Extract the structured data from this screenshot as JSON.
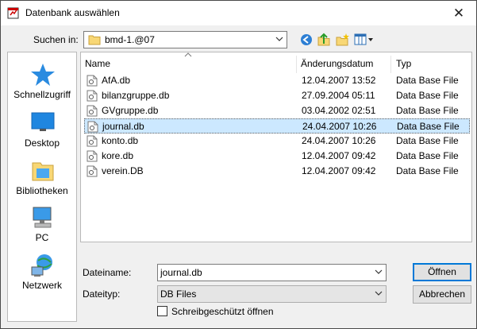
{
  "window": {
    "title": "Datenbank auswählen",
    "close_glyph": "✕"
  },
  "lookin": {
    "label": "Suchen in:",
    "value": "bmd-1.@07"
  },
  "places": [
    {
      "name": "place-quick-access",
      "label": "Schnellzugriff",
      "icon": "star-icon"
    },
    {
      "name": "place-desktop",
      "label": "Desktop",
      "icon": "desktop-icon"
    },
    {
      "name": "place-libraries",
      "label": "Bibliotheken",
      "icon": "libraries-icon"
    },
    {
      "name": "place-pc",
      "label": "PC",
      "icon": "computer-icon"
    },
    {
      "name": "place-network",
      "label": "Netzwerk",
      "icon": "network-icon"
    }
  ],
  "columns": {
    "name": "Name",
    "date": "Änderungsdatum",
    "type": "Typ"
  },
  "files": [
    {
      "name": "AfA.db",
      "date": "12.04.2007 13:52",
      "type": "Data Base File"
    },
    {
      "name": "bilanzgruppe.db",
      "date": "27.09.2004 05:11",
      "type": "Data Base File"
    },
    {
      "name": "GVgruppe.db",
      "date": "03.04.2002 02:51",
      "type": "Data Base File"
    },
    {
      "name": "journal.db",
      "date": "24.04.2007 10:26",
      "type": "Data Base File",
      "selected": true
    },
    {
      "name": "konto.db",
      "date": "24.04.2007 10:26",
      "type": "Data Base File"
    },
    {
      "name": "kore.db",
      "date": "12.04.2007 09:42",
      "type": "Data Base File"
    },
    {
      "name": "verein.DB",
      "date": "12.04.2007 09:42",
      "type": "Data Base File"
    }
  ],
  "filename": {
    "label": "Dateiname:",
    "value": "journal.db"
  },
  "filetype": {
    "label": "Dateityp:",
    "value": "DB Files"
  },
  "readonly": {
    "label": "Schreibgeschützt öffnen",
    "checked": false
  },
  "buttons": {
    "open": "Öffnen",
    "cancel": "Abbrechen"
  },
  "colors": {
    "accent": "#0078d7",
    "selection": "#cce8ff",
    "folder": "#f8d775"
  }
}
